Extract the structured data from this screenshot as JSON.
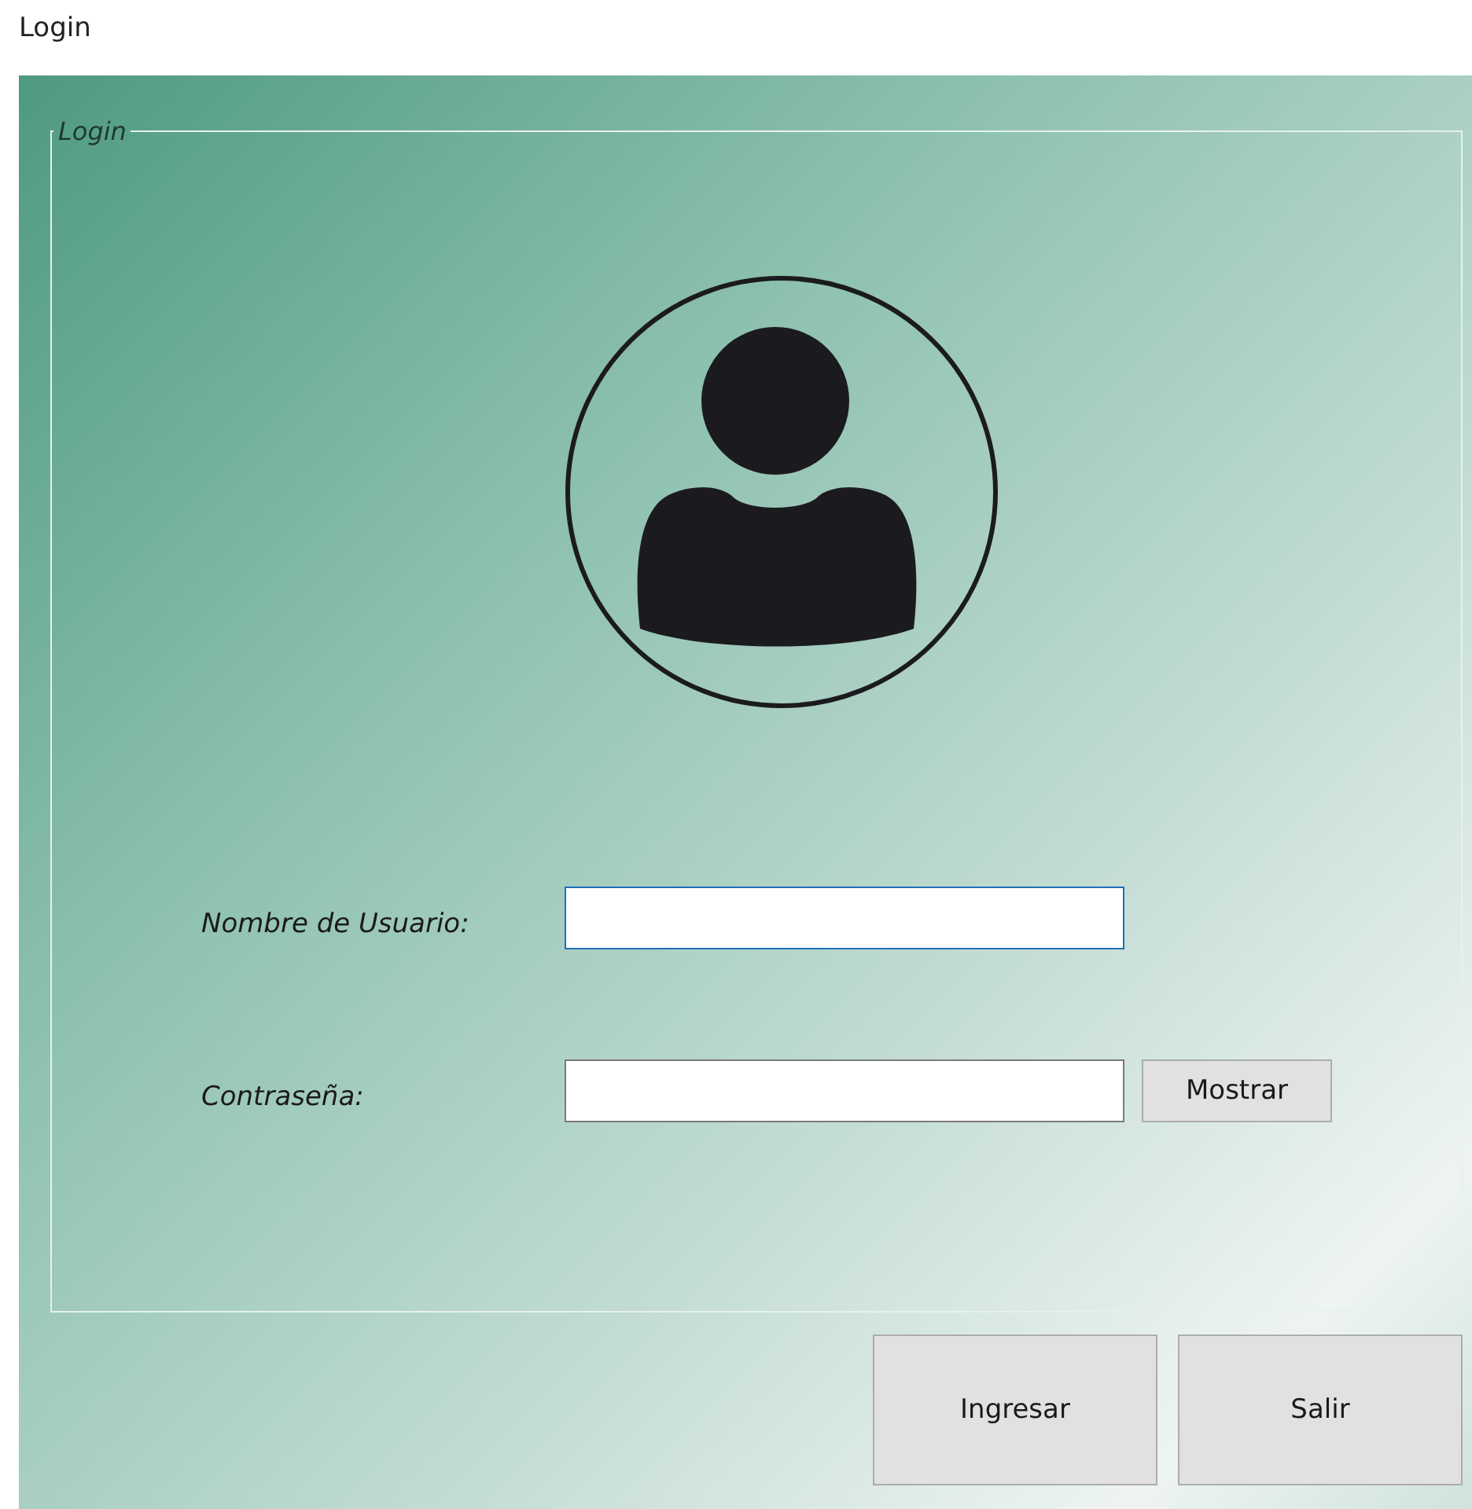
{
  "window": {
    "title": "Login"
  },
  "group": {
    "legend": "Login"
  },
  "fields": [
    {
      "label": "Nombre de Usuario:",
      "focused": true
    },
    {
      "label": "Contraseña:",
      "focused": false,
      "button": "Mostrar"
    }
  ],
  "buttons": [
    "Ingresar",
    "Salir"
  ]
}
